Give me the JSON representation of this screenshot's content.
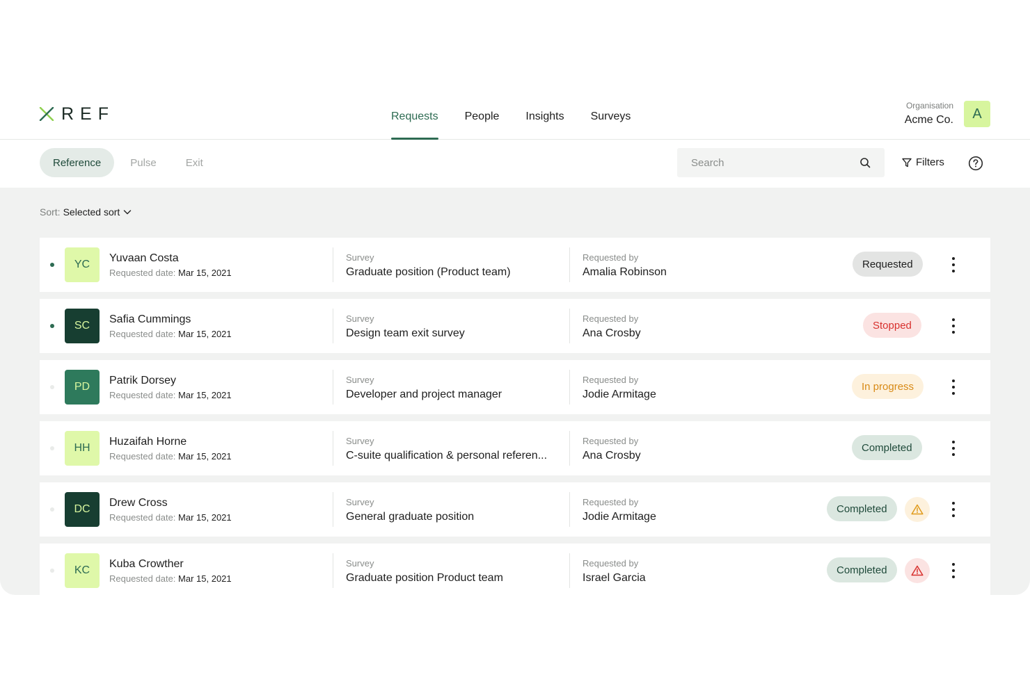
{
  "logo": {
    "text": "REF"
  },
  "nav": {
    "tabs": [
      {
        "label": "Requests",
        "active": true
      },
      {
        "label": "People",
        "active": false
      },
      {
        "label": "Insights",
        "active": false
      },
      {
        "label": "Surveys",
        "active": false
      }
    ]
  },
  "org": {
    "label": "Organisation",
    "name": "Acme Co.",
    "avatar": "A"
  },
  "segments": [
    {
      "label": "Reference",
      "active": true
    },
    {
      "label": "Pulse",
      "active": false
    },
    {
      "label": "Exit",
      "active": false
    }
  ],
  "search": {
    "placeholder": "Search",
    "icon": "search-icon"
  },
  "filters": {
    "label": "Filters",
    "icon": "filter-icon"
  },
  "help": {
    "icon": "help-icon"
  },
  "sort": {
    "label": "Sort:",
    "value": "Selected sort"
  },
  "columns": {
    "survey": "Survey",
    "requested_by": "Requested by",
    "date_label": "Requested date:"
  },
  "colors": {
    "accent": "#2d6b52",
    "lime": "#d7f59e",
    "dark": "#173e31"
  },
  "rows": [
    {
      "initials": "YC",
      "name": "Yuvaan Costa",
      "date": "Mar 15, 2021",
      "survey": "Graduate position (Product team)",
      "requester": "Amalia Robinson",
      "status": "Requested"
    },
    {
      "initials": "SC",
      "name": "Safia Cummings",
      "date": "Mar 15, 2021",
      "survey": "Design team exit survey",
      "requester": "Ana Crosby",
      "status": "Stopped"
    },
    {
      "initials": "PD",
      "name": "Patrik Dorsey",
      "date": "Mar 15, 2021",
      "survey": "Developer and project manager",
      "requester": "Jodie Armitage",
      "status": "In progress"
    },
    {
      "initials": "HH",
      "name": "Huzaifah Horne",
      "date": "Mar 15, 2021",
      "survey": "C-suite qualification & personal referen...",
      "requester": "Ana Crosby",
      "status": "Completed"
    },
    {
      "initials": "DC",
      "name": "Drew Cross",
      "date": "Mar 15, 2021",
      "survey": "General graduate position",
      "requester": "Jodie Armitage",
      "status": "Completed"
    },
    {
      "initials": "KC",
      "name": "Kuba Crowther",
      "date": "Mar 15, 2021",
      "survey": "Graduate position Product team",
      "requester": "Israel Garcia",
      "status": "Completed"
    }
  ]
}
